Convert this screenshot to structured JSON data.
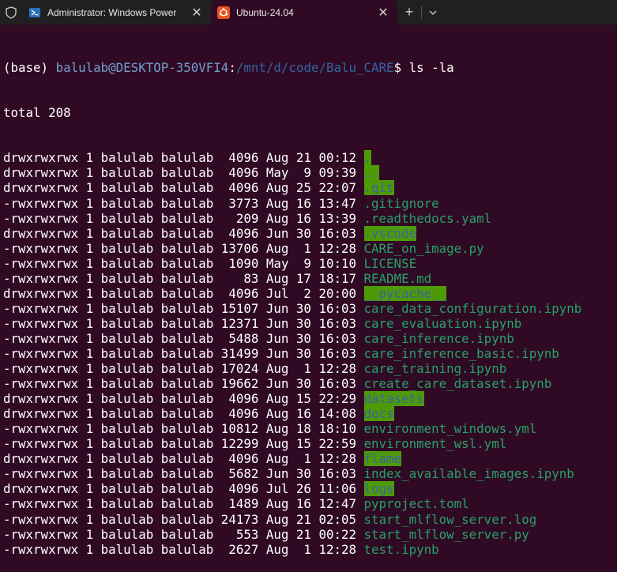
{
  "tabs": [
    {
      "label": "Administrator: Windows Power",
      "icon": "powershell-icon"
    },
    {
      "label": "Ubuntu-24.04",
      "icon": "ubuntu-icon"
    }
  ],
  "prompt": {
    "env": "(base) ",
    "user_host": "balulab@DESKTOP-350VFI4",
    "colon": ":",
    "path": "/mnt/d/code/Balu_CARE",
    "symbol": "$ ",
    "command": "ls -la"
  },
  "total": "total 208",
  "entries": [
    {
      "meta": "drwxrwxrwx 1 balulab balulab  4096 Aug 21 00:12 ",
      "name": ".",
      "hl": true
    },
    {
      "meta": "drwxrwxrwx 1 balulab balulab  4096 May  9 09:39 ",
      "name": "..",
      "hl": true
    },
    {
      "meta": "drwxrwxrwx 1 balulab balulab  4096 Aug 25 22:07 ",
      "name": ".git",
      "hl": true
    },
    {
      "meta": "-rwxrwxrwx 1 balulab balulab  3773 Aug 16 13:47 ",
      "name": ".gitignore",
      "hl": false
    },
    {
      "meta": "-rwxrwxrwx 1 balulab balulab   209 Aug 16 13:39 ",
      "name": ".readthedocs.yaml",
      "hl": false
    },
    {
      "meta": "drwxrwxrwx 1 balulab balulab  4096 Jun 30 16:03 ",
      "name": ".vscode",
      "hl": true
    },
    {
      "meta": "-rwxrwxrwx 1 balulab balulab 13706 Aug  1 12:28 ",
      "name": "CARE_on_image.py",
      "hl": false
    },
    {
      "meta": "-rwxrwxrwx 1 balulab balulab  1090 May  9 10:10 ",
      "name": "LICENSE",
      "hl": false
    },
    {
      "meta": "-rwxrwxrwx 1 balulab balulab    83 Aug 17 18:17 ",
      "name": "README.md",
      "hl": false
    },
    {
      "meta": "drwxrwxrwx 1 balulab balulab  4096 Jul  2 20:00 ",
      "name": "__pycache__",
      "hl": true
    },
    {
      "meta": "-rwxrwxrwx 1 balulab balulab 15107 Jun 30 16:03 ",
      "name": "care_data_configuration.ipynb",
      "hl": false
    },
    {
      "meta": "-rwxrwxrwx 1 balulab balulab 12371 Jun 30 16:03 ",
      "name": "care_evaluation.ipynb",
      "hl": false
    },
    {
      "meta": "-rwxrwxrwx 1 balulab balulab  5488 Jun 30 16:03 ",
      "name": "care_inference.ipynb",
      "hl": false
    },
    {
      "meta": "-rwxrwxrwx 1 balulab balulab 31499 Jun 30 16:03 ",
      "name": "care_inference_basic.ipynb",
      "hl": false
    },
    {
      "meta": "-rwxrwxrwx 1 balulab balulab 17024 Aug  1 12:28 ",
      "name": "care_training.ipynb",
      "hl": false
    },
    {
      "meta": "-rwxrwxrwx 1 balulab balulab 19662 Jun 30 16:03 ",
      "name": "create_care_dataset.ipynb",
      "hl": false
    },
    {
      "meta": "drwxrwxrwx 1 balulab balulab  4096 Aug 15 22:29 ",
      "name": "datasets",
      "hl": true
    },
    {
      "meta": "drwxrwxrwx 1 balulab balulab  4096 Aug 16 14:08 ",
      "name": "docs",
      "hl": true
    },
    {
      "meta": "-rwxrwxrwx 1 balulab balulab 10812 Aug 18 18:10 ",
      "name": "environment_windows.yml",
      "hl": false
    },
    {
      "meta": "-rwxrwxrwx 1 balulab balulab 12299 Aug 15 22:59 ",
      "name": "environment_wsl.yml",
      "hl": false
    },
    {
      "meta": "drwxrwxrwx 1 balulab balulab  4096 Aug  1 12:28 ",
      "name": "flame",
      "hl": true
    },
    {
      "meta": "-rwxrwxrwx 1 balulab balulab  5682 Jun 30 16:03 ",
      "name": "index_available_images.ipynb",
      "hl": false
    },
    {
      "meta": "drwxrwxrwx 1 balulab balulab  4096 Jul 26 11:06 ",
      "name": "logs",
      "hl": true
    },
    {
      "meta": "-rwxrwxrwx 1 balulab balulab  1489 Aug 16 12:47 ",
      "name": "pyproject.toml",
      "hl": false
    },
    {
      "meta": "-rwxrwxrwx 1 balulab balulab 24173 Aug 21 02:05 ",
      "name": "start_mlflow_server.log",
      "hl": false
    },
    {
      "meta": "-rwxrwxrwx 1 balulab balulab   553 Aug 21 00:22 ",
      "name": "start_mlflow_server.py",
      "hl": false
    },
    {
      "meta": "-rwxrwxrwx 1 balulab balulab  2627 Aug  1 12:28 ",
      "name": "test.ipynb",
      "hl": false
    }
  ],
  "colors": {
    "terminal_bg": "#300a24",
    "tabbar_bg": "#202020",
    "dir_highlight": "#4e9a06",
    "dir_text": "#3465a4",
    "file_text": "#26a269",
    "prompt_path": "#3465a4"
  }
}
